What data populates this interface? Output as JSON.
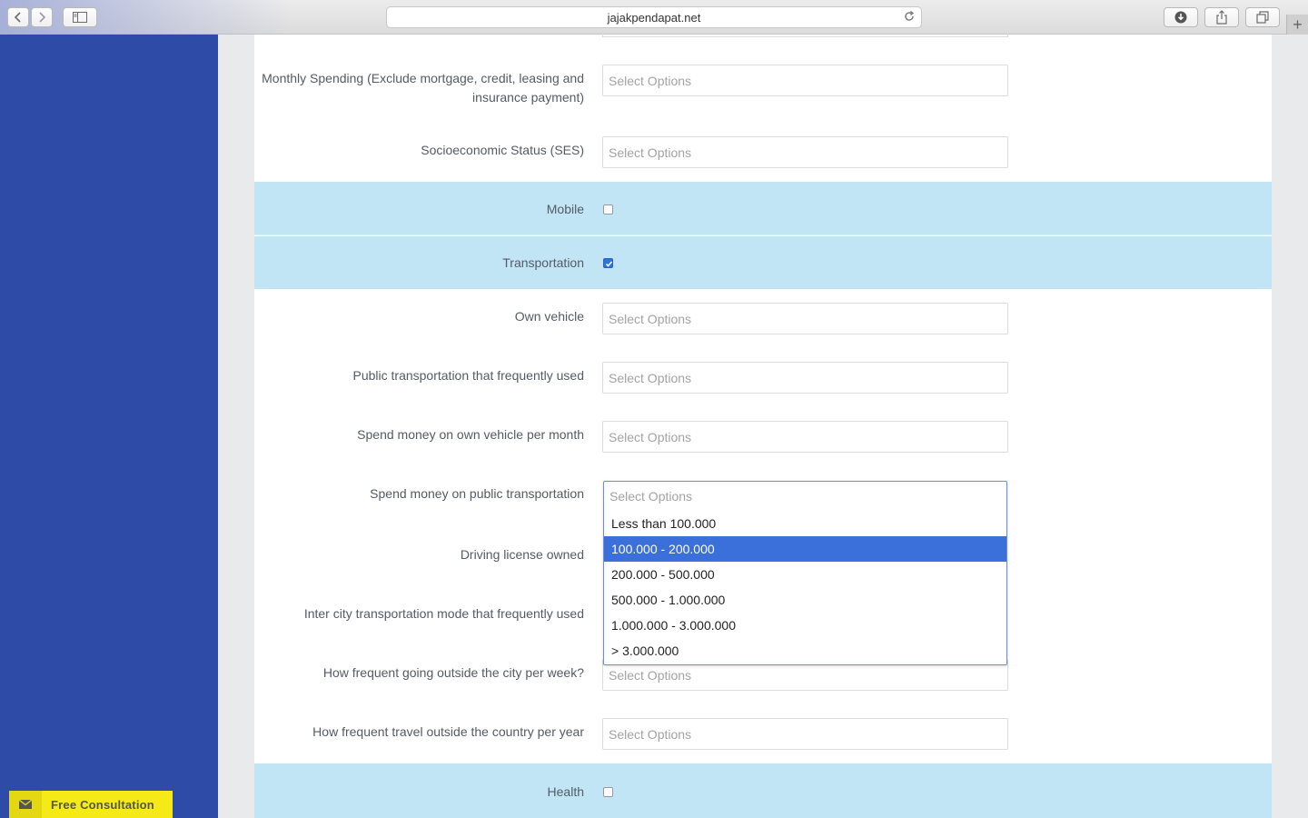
{
  "browser": {
    "url": "jajakpendapat.net"
  },
  "form": {
    "placeholder": "Select Options",
    "fields": [
      {
        "label": "Monthly Spending (Exclude mortgage, credit, leasing and insurance payment)"
      },
      {
        "label": "Socioeconomic Status (SES)"
      },
      {
        "label": "Own vehicle"
      },
      {
        "label": "Public transportation that frequently used"
      },
      {
        "label": "Spend money on own vehicle per month"
      },
      {
        "label": "Spend money on public transportation"
      },
      {
        "label": "Driving license owned"
      },
      {
        "label": "Inter city transportation mode that frequently used"
      },
      {
        "label": "How frequent going outside the city per week?"
      },
      {
        "label": "How frequent travel outside the country per year"
      }
    ],
    "categories": [
      {
        "label": "Mobile",
        "checked": false
      },
      {
        "label": "Transportation",
        "checked": true
      },
      {
        "label": "Health",
        "checked": false
      }
    ]
  },
  "dropdown": {
    "placeholder": "Select Options",
    "options": [
      "Less than 100.000",
      "100.000 - 200.000",
      "200.000 - 500.000",
      "500.000 - 1.000.000",
      "1.000.000 - 3.000.000",
      "> 3.000.000"
    ],
    "highlighted_index": 1,
    "highlight_color": "#3b6fd9"
  },
  "consultation": {
    "label": "Free Consultation",
    "icon": "envelope-icon"
  },
  "colors": {
    "sidebar": "#2f4ba8",
    "category_row": "#c2e5f5",
    "consult_button": "#f5ea18"
  }
}
